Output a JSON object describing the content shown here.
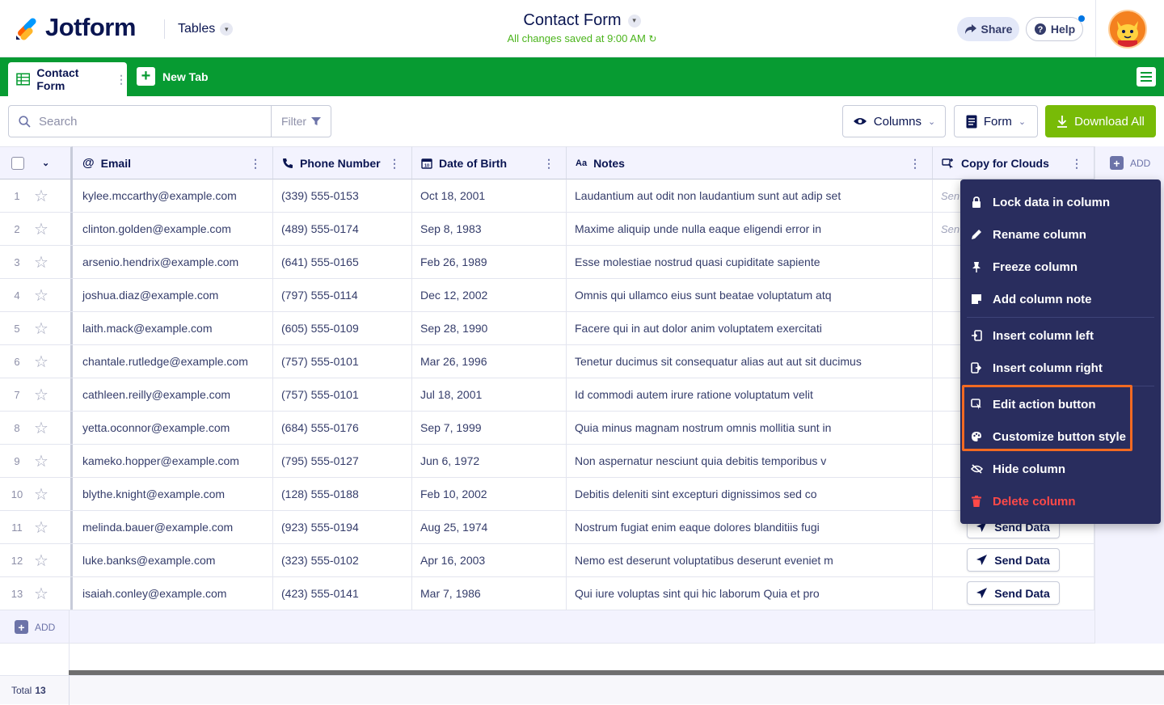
{
  "app": {
    "brand": "Jotform",
    "section": "Tables"
  },
  "doc": {
    "title": "Contact Form",
    "saved": "All changes saved at 9:00 AM"
  },
  "header_actions": {
    "share": "Share",
    "help": "Help"
  },
  "tabs": {
    "active": "Contact Form",
    "new": "New Tab"
  },
  "toolbar": {
    "search_placeholder": "Search",
    "filter": "Filter",
    "columns": "Columns",
    "form": "Form",
    "download": "Download All"
  },
  "columns": {
    "email": "Email",
    "phone": "Phone Number",
    "dob": "Date of Birth",
    "notes": "Notes",
    "action": "Copy for Clouds",
    "add": "ADD"
  },
  "rows": [
    {
      "n": "1",
      "email": "kylee.mccarthy@example.com",
      "phone": "(339) 555-0153",
      "dob": "Oct 18, 2001",
      "notes": "Laudantium aut odit non laudantium sunt aut adip set",
      "action": "Sen"
    },
    {
      "n": "2",
      "email": "clinton.golden@example.com",
      "phone": "(489) 555-0174",
      "dob": "Sep 8, 1983",
      "notes": "Maxime aliquip unde nulla eaque eligendi error in",
      "action": "Sen"
    },
    {
      "n": "3",
      "email": "arsenio.hendrix@example.com",
      "phone": "(641) 555-0165",
      "dob": "Feb 26, 1989",
      "notes": "Esse molestiae nostrud quasi cupiditate sapiente",
      "action": ""
    },
    {
      "n": "4",
      "email": "joshua.diaz@example.com",
      "phone": "(797) 555-0114",
      "dob": "Dec 12, 2002",
      "notes": "Omnis qui ullamco eius sunt beatae voluptatum atq",
      "action": ""
    },
    {
      "n": "5",
      "email": "laith.mack@example.com",
      "phone": "(605) 555-0109",
      "dob": "Sep 28, 1990",
      "notes": "Facere qui in aut dolor anim voluptatem exercitati",
      "action": ""
    },
    {
      "n": "6",
      "email": "chantale.rutledge@example.com",
      "phone": "(757) 555-0101",
      "dob": "Mar 26, 1996",
      "notes": "Tenetur ducimus sit consequatur alias aut aut sit ducimus",
      "action": ""
    },
    {
      "n": "7",
      "email": "cathleen.reilly@example.com",
      "phone": "(757) 555-0101",
      "dob": "Jul 18, 2001",
      "notes": "Id commodi autem irure ratione voluptatum velit",
      "action": ""
    },
    {
      "n": "8",
      "email": "yetta.oconnor@example.com",
      "phone": "(684) 555-0176",
      "dob": "Sep 7, 1999",
      "notes": "Quia minus magnam nostrum omnis mollitia sunt in",
      "action": ""
    },
    {
      "n": "9",
      "email": "kameko.hopper@example.com",
      "phone": "(795) 555-0127",
      "dob": "Jun 6, 1972",
      "notes": "Non aspernatur nesciunt quia debitis temporibus v",
      "action": ""
    },
    {
      "n": "10",
      "email": "blythe.knight@example.com",
      "phone": "(128) 555-0188",
      "dob": "Feb 10, 2002",
      "notes": "Debitis deleniti sint excepturi dignissimos sed co",
      "action": ""
    },
    {
      "n": "11",
      "email": "melinda.bauer@example.com",
      "phone": "(923) 555-0194",
      "dob": "Aug 25, 1974",
      "notes": "Nostrum fugiat enim eaque dolores blanditiis fugi",
      "action": "Send Data"
    },
    {
      "n": "12",
      "email": "luke.banks@example.com",
      "phone": "(323) 555-0102",
      "dob": "Apr 16, 2003",
      "notes": "Nemo est deserunt voluptatibus deserunt eveniet m",
      "action": "Send Data"
    },
    {
      "n": "13",
      "email": "isaiah.conley@example.com",
      "phone": "(423) 555-0141",
      "dob": "Mar 7, 1986",
      "notes": "Qui iure voluptas sint qui hic laborum Quia et pro",
      "action": "Send Data"
    }
  ],
  "add_row": "ADD",
  "footer": {
    "total_label": "Total",
    "total_count": "13"
  },
  "context_menu": {
    "lock": "Lock data in column",
    "rename": "Rename column",
    "freeze": "Freeze column",
    "note": "Add column note",
    "insert_left": "Insert column left",
    "insert_right": "Insert column right",
    "edit_action": "Edit action button",
    "customize": "Customize button style",
    "hide": "Hide column",
    "delete": "Delete column"
  },
  "colors": {
    "green": "#079b32",
    "download": "#78bb07",
    "menu_bg": "#292d5e",
    "highlight": "#f26a22",
    "danger": "#ff4948"
  }
}
